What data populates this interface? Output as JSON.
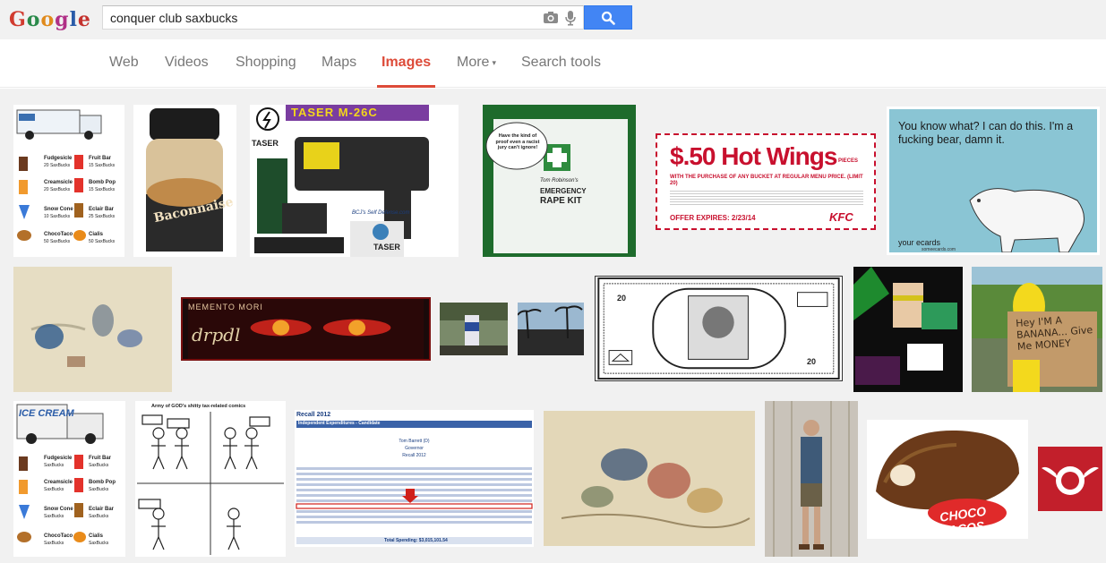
{
  "logo": {
    "letters": [
      "G",
      "o",
      "o",
      "g",
      "l",
      "e"
    ],
    "colors": [
      "#d13b2f",
      "#2a8a4a",
      "#e08a1c",
      "#b02f86",
      "#2a5ca8",
      "#c4322e"
    ]
  },
  "search": {
    "query": "conquer club saxbucks",
    "placeholder": ""
  },
  "nav": {
    "tabs": [
      {
        "label": "Web",
        "active": false
      },
      {
        "label": "Videos",
        "active": false
      },
      {
        "label": "Shopping",
        "active": false
      },
      {
        "label": "Maps",
        "active": false
      },
      {
        "label": "Images",
        "active": true
      },
      {
        "label": "More",
        "active": false
      },
      {
        "label": "Search tools",
        "active": false
      }
    ],
    "more_caret": "▾"
  },
  "colors": {
    "accent": "#dd4b39",
    "search_button": "#4285f4",
    "tab_text": "#777777"
  },
  "images": {
    "ice_cream_menu": {
      "items": [
        {
          "name": "Fudgesicle",
          "price": "20 SaxBucks"
        },
        {
          "name": "Fruit Bar",
          "price": "15 SaxBucks"
        },
        {
          "name": "Creamsicle",
          "price": "20 SaxBucks"
        },
        {
          "name": "Bomb Pop",
          "price": "15 SaxBucks"
        },
        {
          "name": "Snow Cone",
          "price": "10 SaxBucks"
        },
        {
          "name": "Eclair Bar",
          "price": "25 SaxBucks"
        },
        {
          "name": "ChocoTaco",
          "price": "50 SaxBucks"
        },
        {
          "name": "Cialis",
          "price": "50 SaxBucks"
        }
      ]
    },
    "baconnaise": {
      "label": "Baconnaise"
    },
    "taser": {
      "title": "TASER M-26C",
      "brand": "TASER",
      "site": "BCJ's Self Defense.com"
    },
    "rape_kit": {
      "bubble": "Have the kind of proof even a racist jury can't ignore!",
      "line1": "Tom Robinson's",
      "line2": "EMERGENCY",
      "line3": "RAPE KIT"
    },
    "hot_wings": {
      "headline": "$.50 Hot Wings",
      "pieces": "PIECES",
      "sub": "WITH THE PURCHASE OF ANY BUCKET AT REGULAR MENU PRICE. (LIMIT 20)",
      "expires": "OFFER EXPIRES: 2/23/14",
      "brand": "KFC"
    },
    "ecard": {
      "text": "You know what? I can do this. I'm a fucking bear, damn it.",
      "brand": "your ecards",
      "brand_sub": "someecards.com"
    },
    "memento": {
      "title": "MEMENTO MORI",
      "sig": "drpdl"
    },
    "banknote": {
      "value": "20"
    },
    "banana": {
      "sign": "Hey I'M A BANANA... Give Me MONEY"
    },
    "ice_cream_menu_2": {
      "items": [
        {
          "name": "Fudgesicle",
          "price": "SaxBucks"
        },
        {
          "name": "Fruit Bar",
          "price": "SaxBucks"
        },
        {
          "name": "Creamsicle",
          "price": "SaxBucks"
        },
        {
          "name": "Bomb Pop",
          "price": "SaxBucks"
        },
        {
          "name": "Snow Cone",
          "price": "SaxBucks"
        },
        {
          "name": "Eclair Bar",
          "price": "SaxBucks"
        },
        {
          "name": "ChocoTaco",
          "price": "SaxBucks"
        },
        {
          "name": "Cialis",
          "price": "SaxBucks"
        }
      ]
    },
    "comic": {
      "title": "Army of GOD's shitty tax-related comics"
    },
    "recall": {
      "title": "Recall 2012",
      "header": "Independent Expenditures - Candidate",
      "candidate": "Tom Barrett (D)",
      "office": "Governor",
      "election": "Recall 2012",
      "total": "Total Spending: $3,015,101.54"
    },
    "choco_taco": {
      "label": "CHOCO TACOS"
    }
  }
}
